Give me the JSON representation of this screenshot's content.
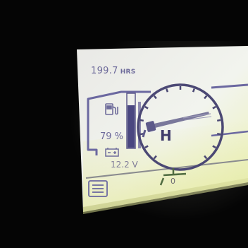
{
  "hours": {
    "value": "199.7",
    "unit": "HRS"
  },
  "fuel": {
    "percent_label": "79 %",
    "level": 0.79
  },
  "battery": {
    "voltage": "12.2 V"
  },
  "gear": {
    "label": "H"
  },
  "lower_gauge": {
    "value": "0"
  },
  "icons": [
    "fuel-pump-icon",
    "battery-icon",
    "menu-list-icon",
    "tachometer-needle-icon"
  ]
}
